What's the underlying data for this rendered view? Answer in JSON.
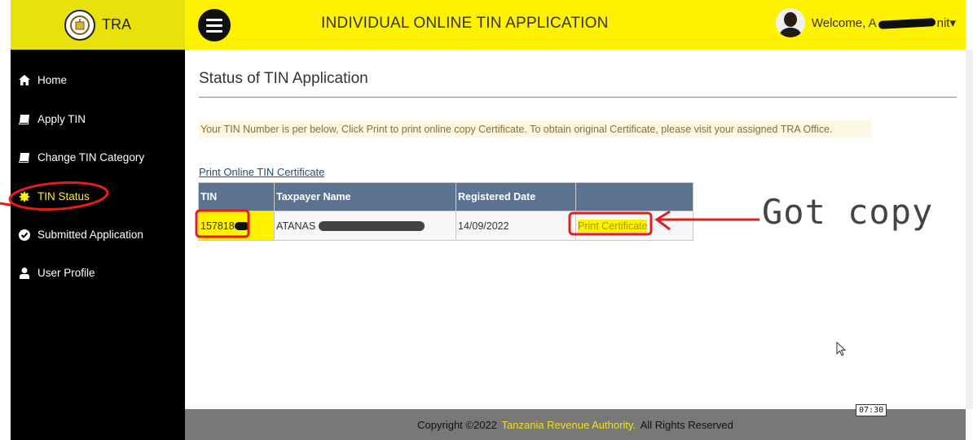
{
  "header": {
    "brand": "TRA",
    "app_title": "INDIVIDUAL ONLINE TIN APPLICATION",
    "welcome_prefix": "Welcome, A",
    "welcome_suffix": "nit",
    "dropdown_glyph": "▾"
  },
  "sidebar": {
    "items": [
      {
        "label": "Home",
        "icon": "home-icon"
      },
      {
        "label": "Apply TIN",
        "icon": "book-icon"
      },
      {
        "label": "Change TIN Category",
        "icon": "book-icon"
      },
      {
        "label": "TIN Status",
        "icon": "certificate-icon",
        "active": true
      },
      {
        "label": "Submitted Application",
        "icon": "check-circle-icon"
      },
      {
        "label": "User Profile",
        "icon": "user-icon"
      }
    ]
  },
  "main": {
    "title": "Status of TIN Application",
    "notice": "Your TIN Number is per below, Click Print to print online copy Certificate. To obtain original Certificate, please visit your assigned TRA Office.",
    "print_link": "Print Online TIN Certificate",
    "table": {
      "headers": [
        "TIN",
        "Taxpayer Name",
        "Registered Date",
        ""
      ],
      "rows": [
        {
          "tin": "157818",
          "taxpayer": "ATANAS",
          "date": "14/09/2022",
          "action": "Print Certificate"
        }
      ]
    }
  },
  "annotation": {
    "text": "Got copy"
  },
  "footer": {
    "prefix": "Copyright ©2022",
    "org": "Tanzania Revenue Authority.",
    "suffix": "All Rights Reserved"
  },
  "overlay": {
    "time": "07:30"
  },
  "colors": {
    "brand_yellow": "#fff200",
    "sidebar_bg": "#000000",
    "table_header": "#5b7391",
    "annotation_red": "#e01e1e"
  }
}
